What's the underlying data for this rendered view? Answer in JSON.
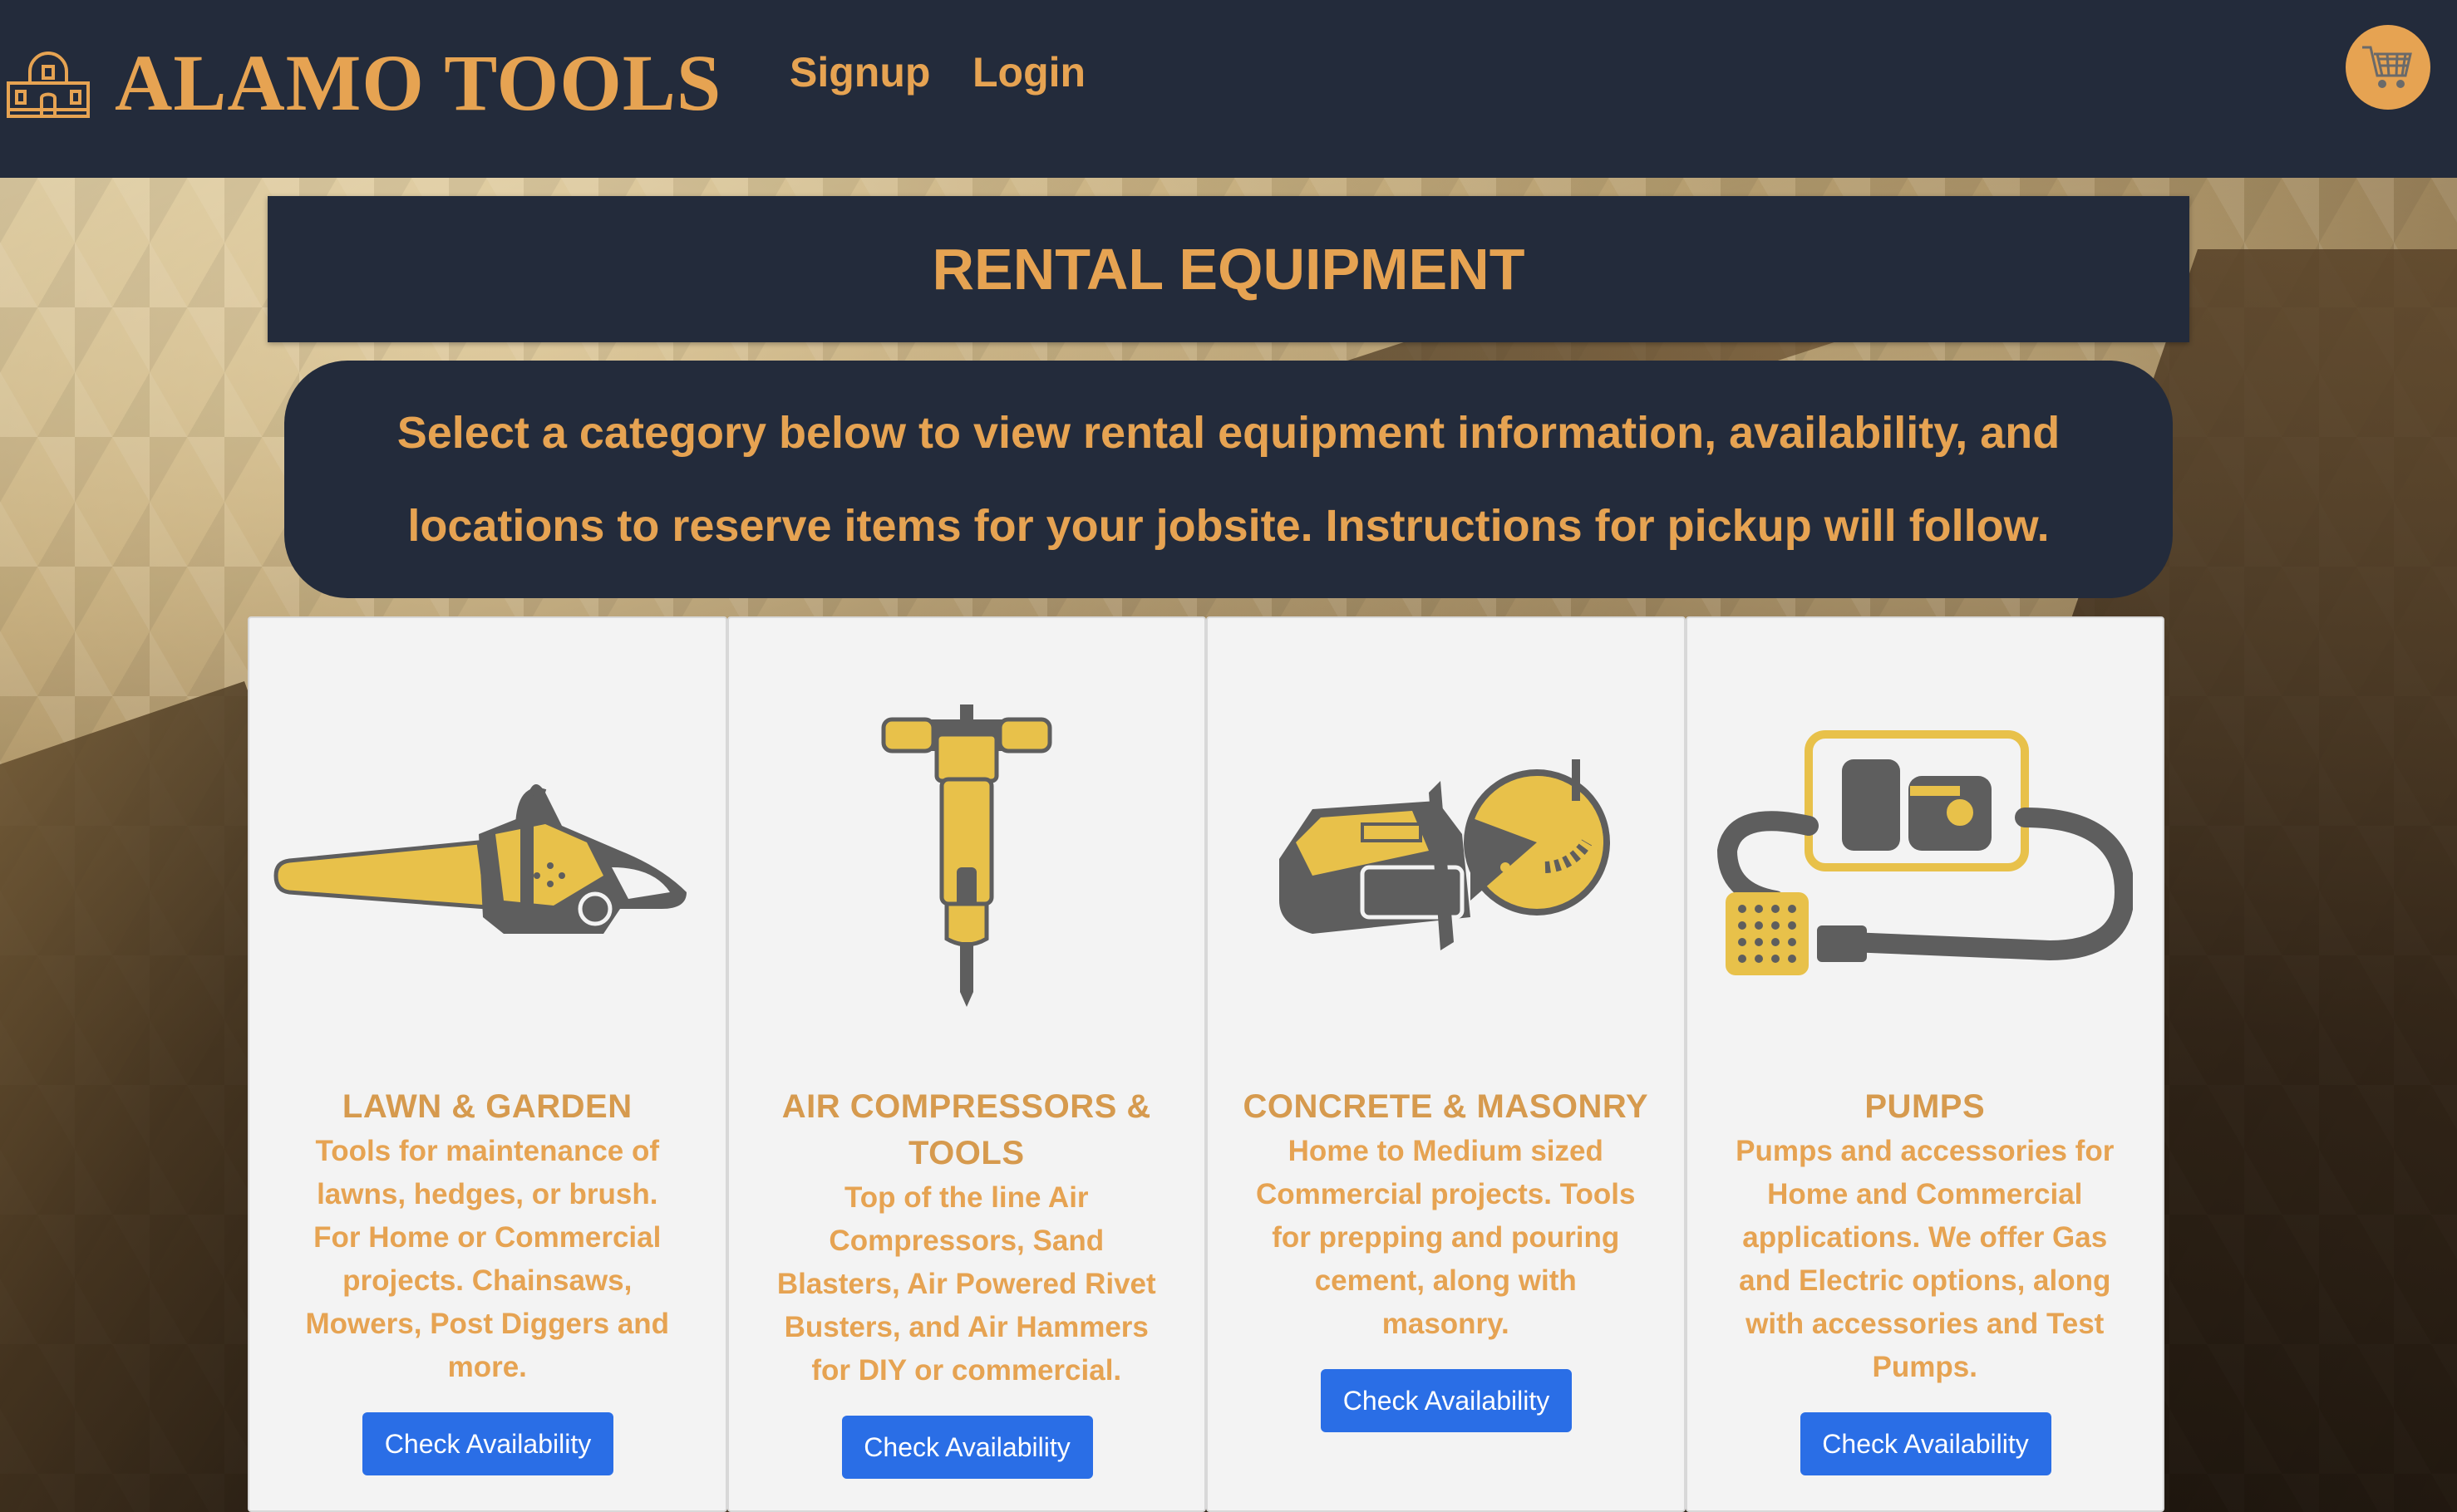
{
  "brand": {
    "name": "ALAMO TOOLS",
    "icon": "alamo-building-icon"
  },
  "nav": {
    "signup": "Signup",
    "login": "Login",
    "cart_icon": "shopping-cart-icon"
  },
  "banner": {
    "title": "RENTAL EQUIPMENT"
  },
  "intro": {
    "line1": "Select a category below to view rental equipment information, availability, and",
    "line2": "locations to reserve items for your jobsite. Instructions for pickup will follow."
  },
  "cards": [
    {
      "icon": "chainsaw-icon",
      "title": [
        "LAWN & GARDEN"
      ],
      "desc": [
        "Tools for maintenance of",
        "lawns, hedges, or brush.",
        "For Home or Commercial",
        "projects. Chainsaws,",
        "Mowers, Post Diggers and",
        "more."
      ],
      "button": "Check Availability"
    },
    {
      "icon": "jackhammer-icon",
      "title": [
        "AIR COMPRESSORS &",
        "TOOLS"
      ],
      "desc": [
        "Top of the line Air",
        "Compressors, Sand",
        "Blasters, Air Powered Rivet",
        "Busters, and Air Hammers",
        "for DIY or commercial."
      ],
      "button": "Check Availability"
    },
    {
      "icon": "concrete-saw-icon",
      "title": [
        "CONCRETE & MASONRY"
      ],
      "desc": [
        "Home to Medium sized",
        "Commercial projects. Tools",
        "for prepping and pouring",
        "cement, along with",
        "masonry."
      ],
      "button": "Check Availability"
    },
    {
      "icon": "water-pump-icon",
      "title": [
        "PUMPS"
      ],
      "desc": [
        "Pumps and accessories for",
        "Home and Commercial",
        "applications. We offer Gas",
        "and Electric options, along",
        "with accessories and Test",
        "Pumps."
      ],
      "button": "Check Availability"
    }
  ],
  "colors": {
    "navy": "#232b3b",
    "accent": "#e6a352",
    "button": "#2a6ee6",
    "tool_yellow": "#e8c14a",
    "tool_gray": "#5e5e5e"
  }
}
